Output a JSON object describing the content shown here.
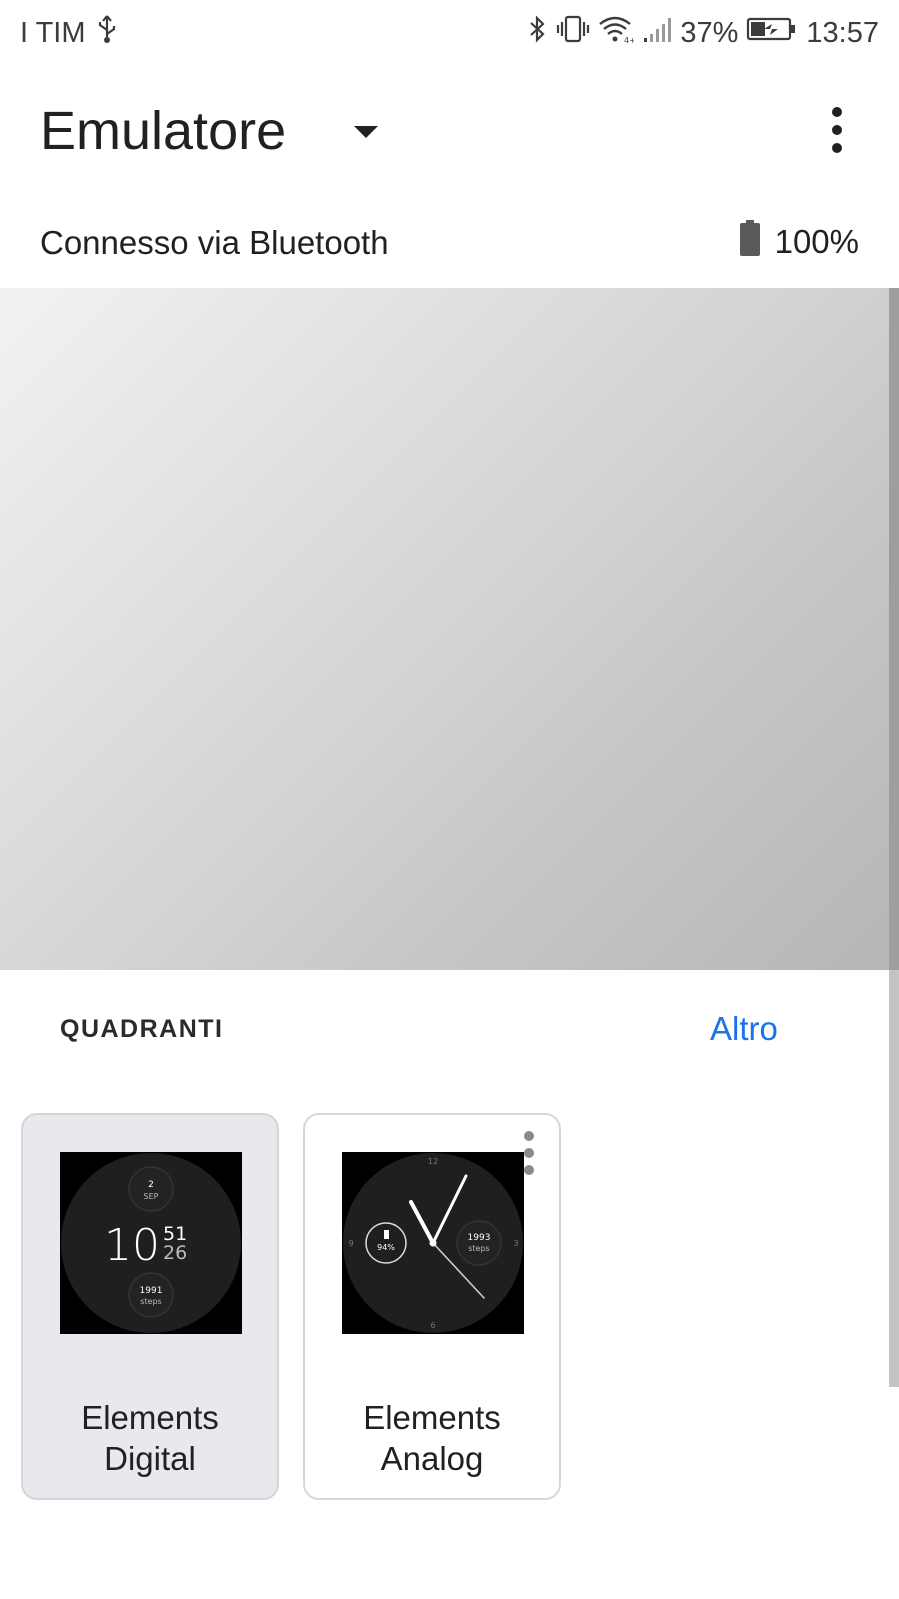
{
  "status_bar": {
    "carrier": "I TIM",
    "battery_percent": "37%",
    "time": "13:57",
    "icons": [
      "usb-icon",
      "bluetooth-icon",
      "vibrate-icon",
      "wifi-icon",
      "signal-icon",
      "battery-charging-icon"
    ]
  },
  "app_bar": {
    "title": "Emulatore",
    "dropdown_icon": "arrow-drop-down-icon",
    "menu_icon": "more-vert-icon"
  },
  "connection": {
    "status": "Connesso via Bluetooth",
    "watch_battery": "100%",
    "battery_icon": "battery-full-icon"
  },
  "watch_faces": {
    "header": "QUADRANTI",
    "more_link": "Altro",
    "cards": [
      {
        "label": "Elements Digital",
        "selected": true,
        "preview": {
          "date_day": "2",
          "date_month": "SEP",
          "hour": "10",
          "minute": "51",
          "second": "26",
          "steps_value": "1991",
          "steps_label": "steps"
        }
      },
      {
        "label": "Elements Analog",
        "selected": false,
        "preview": {
          "battery": "94%",
          "steps_value": "1993",
          "steps_label": "steps",
          "tick_12": "12",
          "tick_3": "3",
          "tick_6": "6",
          "tick_9": "9"
        }
      }
    ]
  },
  "colors": {
    "accent": "#1a73e8",
    "selected_card_bg": "#e8e9ec",
    "watch_dial": "#201e1e"
  }
}
